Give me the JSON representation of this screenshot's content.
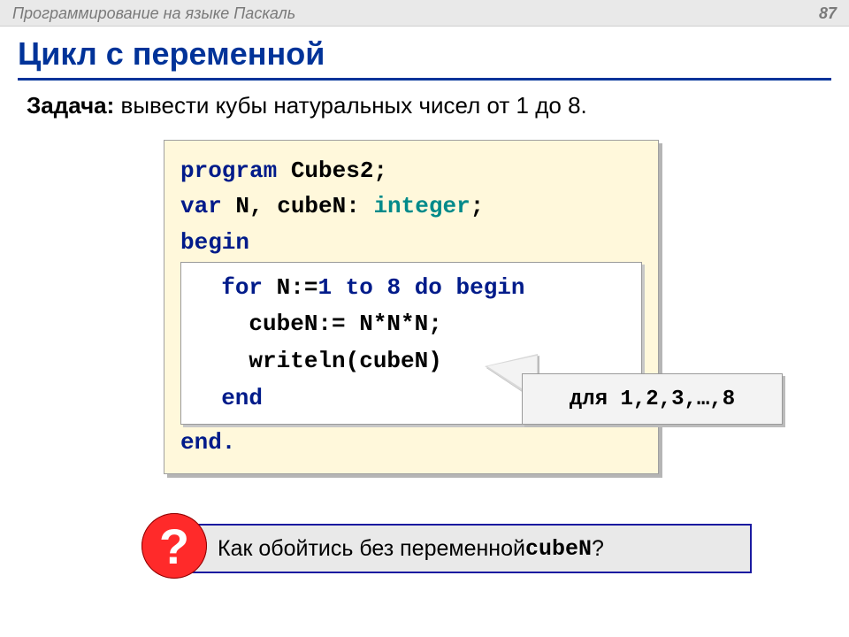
{
  "topbar": {
    "title": "Программирование на языке Паскаль",
    "page": "87"
  },
  "heading": "Цикл с переменной",
  "task": {
    "label": "Задача:",
    "text": " вывести кубы натуральных чисел от 1 до 8."
  },
  "code": {
    "l1_kw_program": "program",
    "l1_name": " Cubes2;",
    "l2_kw_var": "var",
    "l2_vars": " N, cubeN: ",
    "l2_kw_int": "integer",
    "l2_end": ";",
    "l3_begin": "begin",
    "inner": {
      "l1_indent": "  ",
      "l1_for": "for",
      "l1_mid1": " N:=",
      "l1_one": "1",
      "l1_to": " to ",
      "l1_eight": "8",
      "l1_do": " do begin",
      "l2": "    cubeN:= N*N*N;",
      "l3": "    writeln(cubeN)",
      "l4": "  end"
    },
    "l_end": "end."
  },
  "callout": "для 1,2,3,…,8",
  "question": {
    "mark": "?",
    "text_pre": " Как обойтись без переменной ",
    "code": "cubeN",
    "text_post": "?"
  }
}
